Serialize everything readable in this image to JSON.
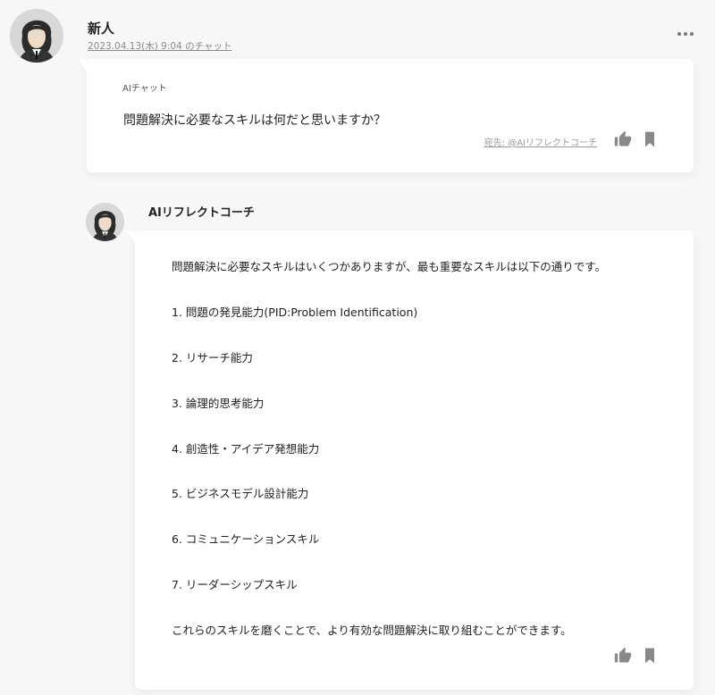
{
  "user": {
    "name": "新人",
    "meta": "2023.04.13(木) 9:04 のチャット"
  },
  "question": {
    "chat_type": "AIチャット",
    "text": "問題解決に必要なスキルは何だと思いますか？",
    "recipient": "宛先: @AIリフレクトコーチ"
  },
  "ai": {
    "name": "AIリフレクトコーチ",
    "answer": {
      "intro": "問題解決に必要なスキルはいくつかありますが、最も重要なスキルは以下の通りです。",
      "items": [
        "1. 問題の発見能力(PID:Problem Identification)",
        "2. リサーチ能力",
        "3. 論理的思考能力",
        "4. 創造性・アイデア発想能力",
        "5. ビジネスモデル設計能力",
        "6. コミュニケーションスキル",
        "7. リーダーシップスキル"
      ],
      "conclusion": "これらのスキルを磨くことで、より有効な問題解決に取り組むことができます。"
    }
  },
  "icons": {
    "thumbs_up": "thumbs-up-icon",
    "bookmark": "bookmark-icon",
    "more": "more-icon"
  },
  "colors": {
    "background": "#f7f7f7",
    "card": "#ffffff",
    "icon": "#888888",
    "meta_text": "#8a8a8a"
  }
}
